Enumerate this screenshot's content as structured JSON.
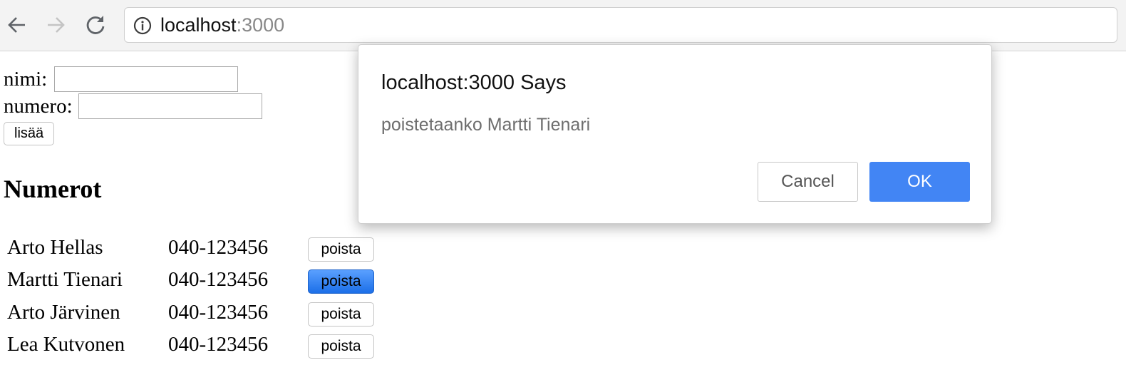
{
  "browser": {
    "url_host": "localhost",
    "url_port": ":3000"
  },
  "form": {
    "name_label": "nimi:",
    "name_value": "",
    "number_label": "numero:",
    "number_value": "",
    "add_label": "lisää"
  },
  "heading": "Numerot",
  "persons": [
    {
      "name": "Arto Hellas",
      "number": "040-123456",
      "delete_label": "poista"
    },
    {
      "name": "Martti Tienari",
      "number": "040-123456",
      "delete_label": "poista"
    },
    {
      "name": "Arto Järvinen",
      "number": "040-123456",
      "delete_label": "poista"
    },
    {
      "name": "Lea Kutvonen",
      "number": "040-123456",
      "delete_label": "poista"
    }
  ],
  "dialog": {
    "title": "localhost:3000 Says",
    "message": "poistetaanko Martti Tienari",
    "cancel_label": "Cancel",
    "ok_label": "OK"
  },
  "colors": {
    "ok_button": "#4285f4",
    "active_delete_button": "#1c6fe8"
  }
}
